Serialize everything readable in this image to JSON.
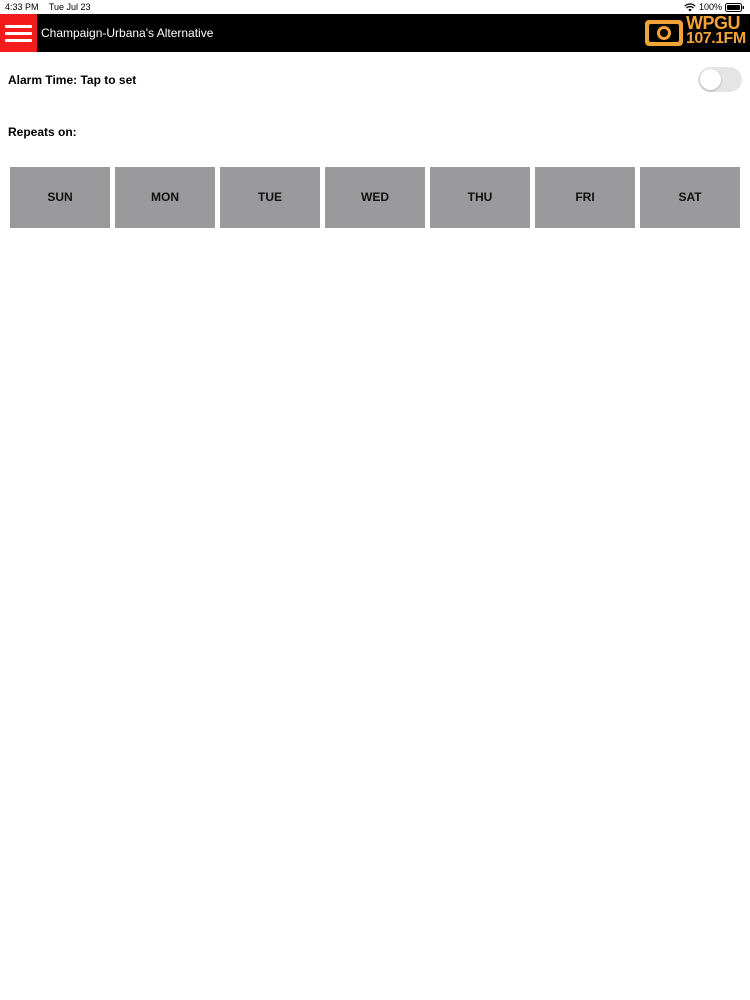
{
  "status_bar": {
    "time": "4:33 PM",
    "date": "Tue Jul 23",
    "battery": "100%",
    "icons": [
      "wifi-icon",
      "battery-icon"
    ]
  },
  "nav_bar": {
    "title": "Champaign-Urbana's Alternative",
    "menu_icon": "hamburger-menu-icon",
    "logo": {
      "line1": "WPGU",
      "line2": "107.1FM"
    },
    "colors": {
      "menu_bg": "#f31b1b",
      "bar_bg": "#000000",
      "logo": "#f2a337"
    }
  },
  "alarm": {
    "label": "Alarm Time: Tap to set",
    "enabled": false
  },
  "repeats": {
    "label": "Repeats on:",
    "days": [
      {
        "label": "SUN",
        "selected": false
      },
      {
        "label": "MON",
        "selected": false
      },
      {
        "label": "TUE",
        "selected": false
      },
      {
        "label": "WED",
        "selected": false
      },
      {
        "label": "THU",
        "selected": false
      },
      {
        "label": "FRI",
        "selected": false
      },
      {
        "label": "SAT",
        "selected": false
      }
    ],
    "colors": {
      "day_bg": "#9a9a9c"
    }
  }
}
